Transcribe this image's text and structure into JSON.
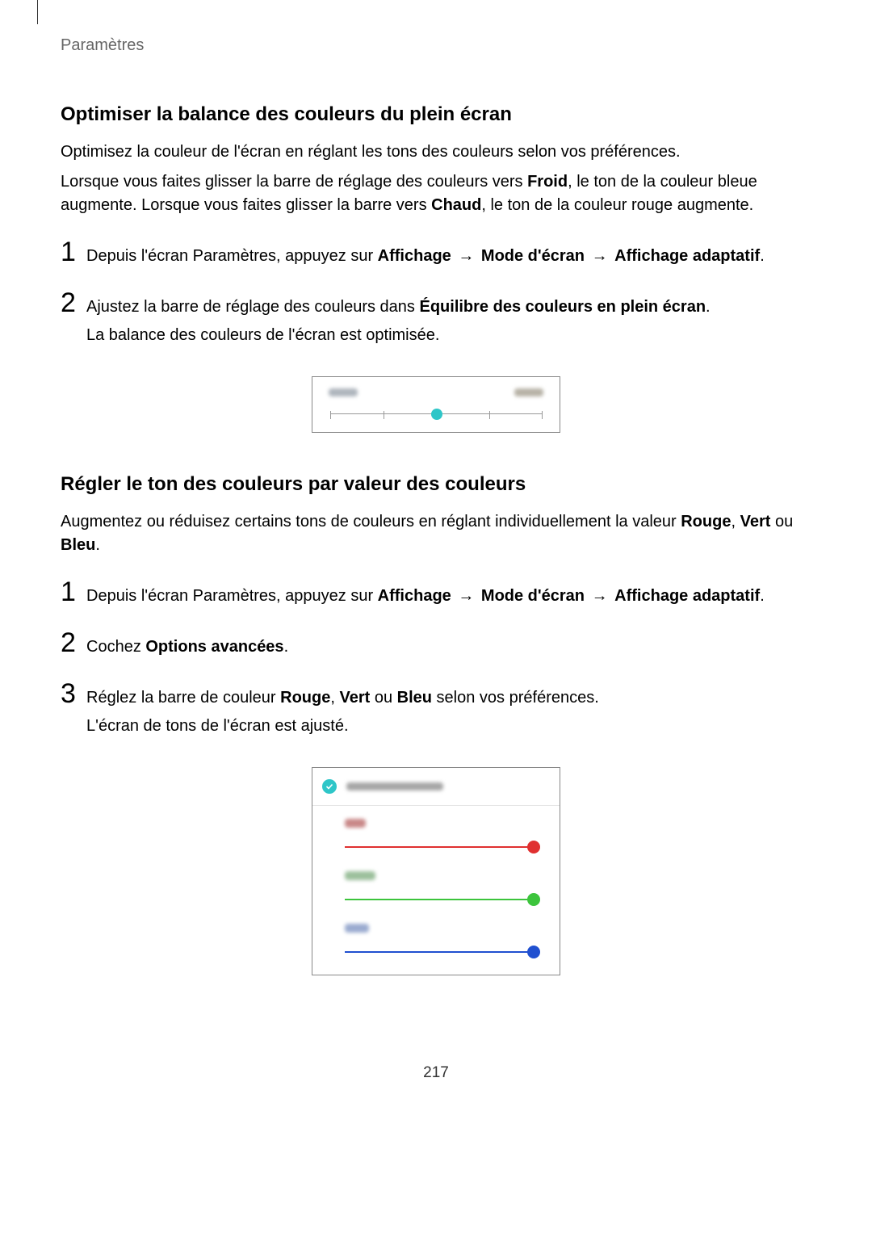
{
  "breadcrumb": "Paramètres",
  "section1": {
    "heading": "Optimiser la balance des couleurs du plein écran",
    "intro1": "Optimisez la couleur de l'écran en réglant les tons des couleurs selon vos préférences.",
    "intro2_pre": "Lorsque vous faites glisser la barre de réglage des couleurs vers ",
    "intro2_b1": "Froid",
    "intro2_mid": ", le ton de la couleur bleue augmente. Lorsque vous faites glisser la barre vers ",
    "intro2_b2": "Chaud",
    "intro2_post": ", le ton de la couleur rouge augmente.",
    "step1": {
      "num": "1",
      "pre": "Depuis l'écran Paramètres, appuyez sur ",
      "b1": "Affichage",
      "arrow1": " → ",
      "b2": "Mode d'écran",
      "arrow2": " → ",
      "b3": "Affichage adaptatif",
      "post": "."
    },
    "step2": {
      "num": "2",
      "line1_pre": "Ajustez la barre de réglage des couleurs dans ",
      "line1_b": "Équilibre des couleurs en plein écran",
      "line1_post": ".",
      "line2": "La balance des couleurs de l'écran est optimisée."
    }
  },
  "section2": {
    "heading": "Régler le ton des couleurs par valeur des couleurs",
    "intro_pre": "Augmentez ou réduisez certains tons de couleurs en réglant individuellement la valeur ",
    "intro_b1": "Rouge",
    "intro_sep1": ", ",
    "intro_b2": "Vert",
    "intro_sep2": " ou ",
    "intro_b3": "Bleu",
    "intro_post": ".",
    "step1": {
      "num": "1",
      "pre": "Depuis l'écran Paramètres, appuyez sur ",
      "b1": "Affichage",
      "arrow1": " → ",
      "b2": "Mode d'écran",
      "arrow2": " → ",
      "b3": "Affichage adaptatif",
      "post": "."
    },
    "step2": {
      "num": "2",
      "pre": "Cochez ",
      "b": "Options avancées",
      "post": "."
    },
    "step3": {
      "num": "3",
      "line1_pre": "Réglez la barre de couleur ",
      "line1_b1": "Rouge",
      "line1_sep1": ", ",
      "line1_b2": "Vert",
      "line1_sep2": " ou ",
      "line1_b3": "Bleu",
      "line1_post": " selon vos préférences.",
      "line2": "L'écran de tons de l'écran est ajusté."
    }
  },
  "figure2": {
    "colors": {
      "red": "#e03030",
      "green": "#3cc43c",
      "blue": "#2050d0"
    }
  },
  "page_number": "217"
}
